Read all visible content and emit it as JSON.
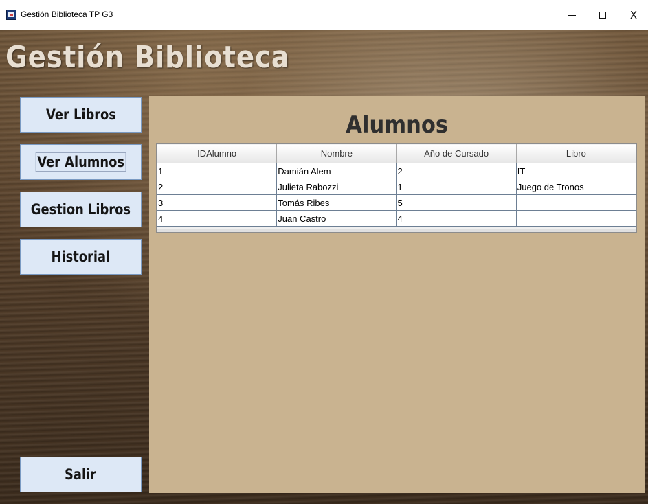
{
  "window": {
    "title": "Gestión Biblioteca TP G3",
    "controls": {
      "minimize": "—",
      "maximize": "☐",
      "close": "X"
    }
  },
  "app": {
    "heading": "Gestión Biblioteca"
  },
  "menu": {
    "ver_libros": "Ver Libros",
    "ver_alumnos": "Ver Alumnos",
    "gestion_libros": "Gestion Libros",
    "historial": "Historial",
    "salir": "Salir"
  },
  "panel": {
    "title": "Alumnos",
    "table": {
      "columns": [
        "IDAlumno",
        "Nombre",
        "Año de Cursado",
        "Libro"
      ],
      "rows": [
        [
          "1",
          "Damián Alem",
          "2",
          "IT"
        ],
        [
          "2",
          "Julieta Rabozzi",
          "1",
          "Juego de Tronos"
        ],
        [
          "3",
          "Tomás Ribes",
          "5",
          ""
        ],
        [
          "4",
          "Juan Castro",
          "4",
          ""
        ]
      ]
    }
  },
  "colors": {
    "panel_bg": "#c9b390",
    "button_bg": "#dde8f6",
    "heading_text": "#e8dfd2"
  }
}
